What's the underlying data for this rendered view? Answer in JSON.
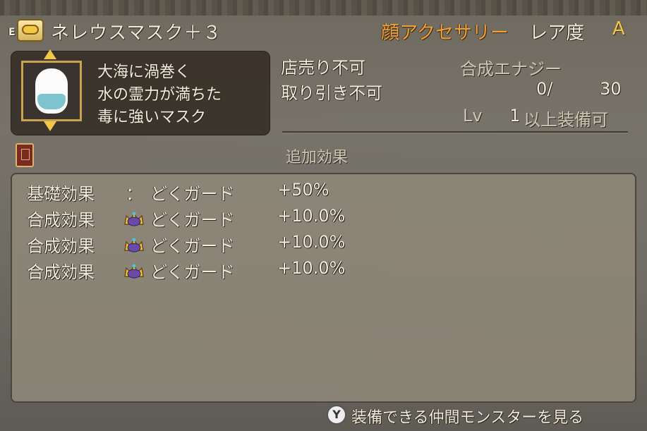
{
  "header": {
    "equipped_mark": "E",
    "item_icon": "accessory-face-icon",
    "item_name": "ネレウスマスク＋３",
    "category": "顔アクセサリー",
    "rarity_label": "レア度",
    "rarity_value": "A"
  },
  "description": {
    "lines": [
      "大海に渦巻く",
      "水の霊力が満ちた",
      "毒に強いマスク"
    ]
  },
  "trade": {
    "shop": "店売り不可",
    "trade": "取り引き不可"
  },
  "synthesis": {
    "label": "合成エナジー",
    "current": "0/",
    "max": "30"
  },
  "level_req": {
    "lv_label": "Lv",
    "lv_value": "1",
    "suffix": "以上装備可"
  },
  "effects": {
    "title": "追加効果",
    "rows": [
      {
        "label": "基礎効果",
        "colon": "：",
        "crown": false,
        "name": "どくガード",
        "value": "+50%"
      },
      {
        "label": "合成効果",
        "colon": "",
        "crown": true,
        "name": "どくガード",
        "value": "+10.0%"
      },
      {
        "label": "合成効果",
        "colon": "",
        "crown": true,
        "name": "どくガード",
        "value": "+10.0%"
      },
      {
        "label": "合成効果",
        "colon": "",
        "crown": true,
        "name": "どくガード",
        "value": "+10.0%"
      }
    ]
  },
  "footer": {
    "button_glyph": "Y",
    "action_label": "装備できる仲間モンスターを見る"
  },
  "colors": {
    "category": "#f2a13a",
    "rarity": "#f2c44a",
    "crown_gold": "#f0c842",
    "crown_purple": "#6a4aa8"
  }
}
